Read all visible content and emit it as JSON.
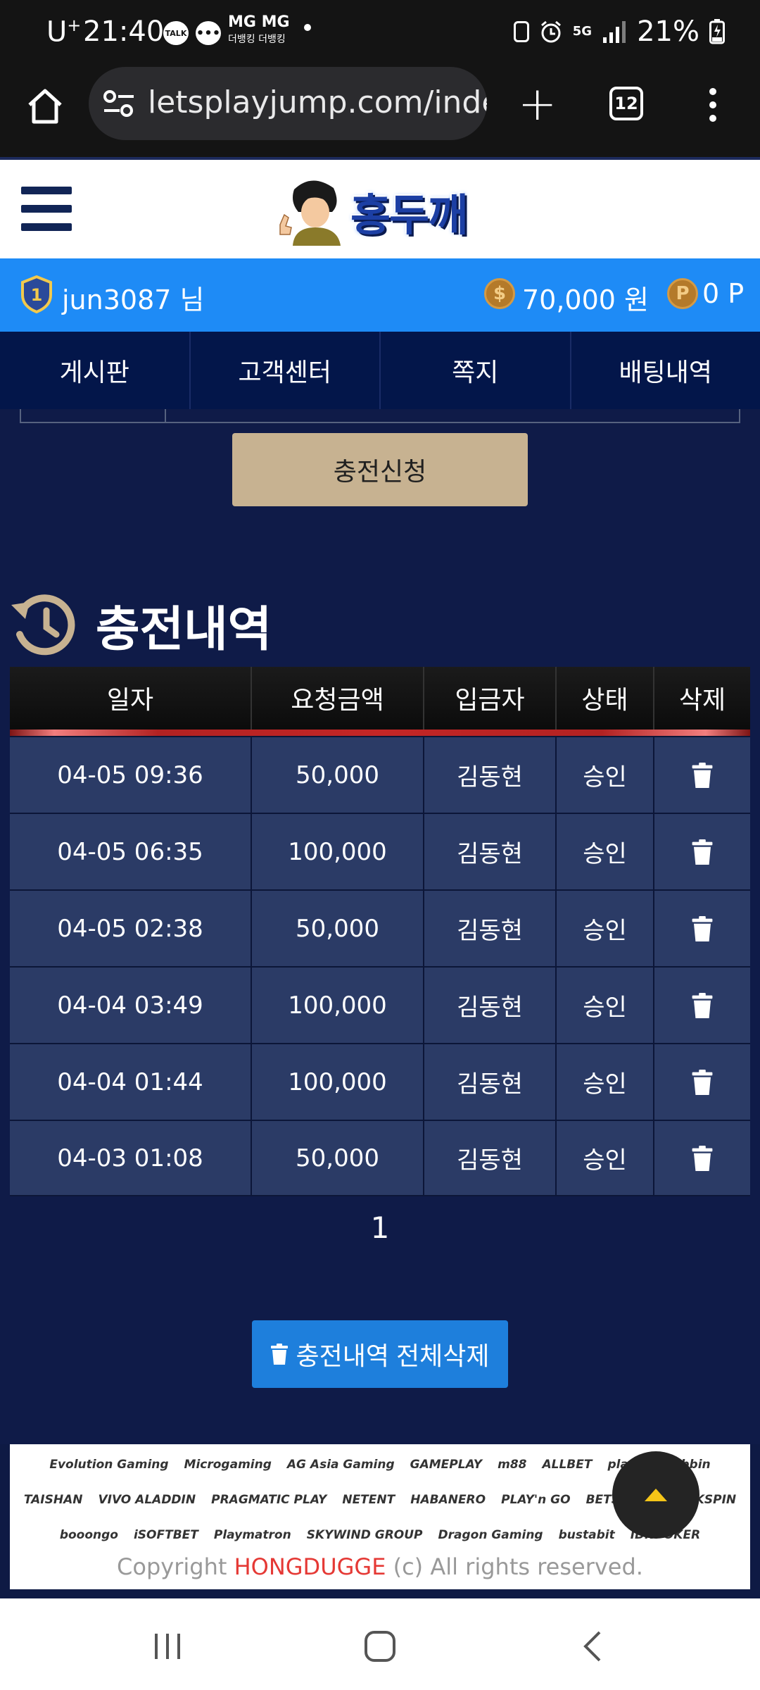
{
  "status_bar": {
    "carrier": "U",
    "carrier_sup": "+",
    "time": "21:40",
    "talk_label": "TALK",
    "mg_title": "MG MG",
    "mg_sub": "더뱅킹 더뱅킹",
    "network": "5G",
    "battery": "21%"
  },
  "browser": {
    "url": "letsplayjump.com/index",
    "tab_count": "12"
  },
  "site": {
    "logo_text": "홍두깨"
  },
  "user_bar": {
    "level": "1",
    "username": "jun3087 님",
    "balance": "70,000 원",
    "points": "0 P",
    "coin_symbol": "$",
    "point_symbol": "P"
  },
  "nav": {
    "items": [
      "게시판",
      "고객센터",
      "쪽지",
      "배팅내역"
    ]
  },
  "content": {
    "charge_button": "충전신청",
    "section_title": "충전내역",
    "table": {
      "headers": [
        "일자",
        "요청금액",
        "입금자",
        "상태",
        "삭제"
      ],
      "rows": [
        {
          "date": "04-05 09:36",
          "amount": "50,000",
          "depositor": "김동현",
          "status": "승인"
        },
        {
          "date": "04-05 06:35",
          "amount": "100,000",
          "depositor": "김동현",
          "status": "승인"
        },
        {
          "date": "04-05 02:38",
          "amount": "50,000",
          "depositor": "김동현",
          "status": "승인"
        },
        {
          "date": "04-04 03:49",
          "amount": "100,000",
          "depositor": "김동현",
          "status": "승인"
        },
        {
          "date": "04-04 01:44",
          "amount": "100,000",
          "depositor": "김동현",
          "status": "승인"
        },
        {
          "date": "04-03 01:08",
          "amount": "50,000",
          "depositor": "김동현",
          "status": "승인"
        }
      ]
    },
    "page": "1",
    "delete_all_button": "충전내역 전체삭제"
  },
  "footer": {
    "providers": [
      "Evolution Gaming",
      "Microgaming",
      "AG Asia Gaming",
      "GAMEPLAY",
      "m88",
      "ALLBET",
      "playtech",
      "bbin",
      "TAISHAN",
      "VIVO ALADDIN",
      "PRAGMATIC PLAY",
      "NETENT",
      "HABANERO",
      "PLAY'n GO",
      "BETSOFT",
      "QUICKSPIN",
      "booongo",
      "iSOFTBET",
      "Playmatron",
      "SKYWIND GROUP",
      "Dragon Gaming",
      "bustabit",
      "IDNPOKER"
    ],
    "copyright_prefix": "Copyright ",
    "copyright_brand": "HONGDUGGE",
    "copyright_suffix": " (c) All rights reserved."
  },
  "colors": {
    "user_bar": "#1e8bf6",
    "nav": "#03164a",
    "content_bg": "#0f1b48",
    "row_bg": "#2b3b66",
    "charge_button": "#c7b291",
    "delete_all_button": "#1e7fdc",
    "brand_red": "#e53935"
  }
}
